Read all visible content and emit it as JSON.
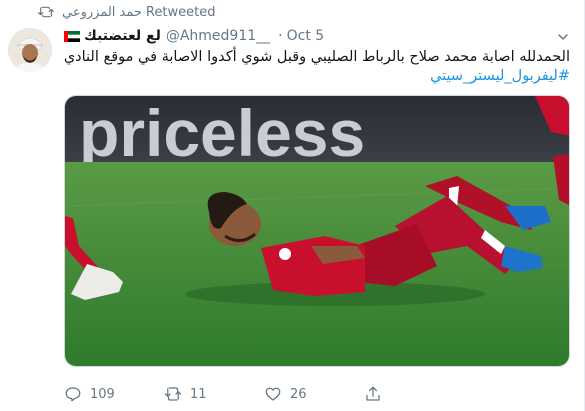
{
  "retweet": {
    "name": "حمد المزروعي",
    "label": "Retweeted"
  },
  "author": {
    "display_name": "لع لعتضتبك",
    "handle": "@Ahmed911__",
    "time": "Oct 5"
  },
  "tweet": {
    "line1": "الحمدلله اصابة محمد صلاح بالرباط الصليبي وقبل شوي أكدوا الاصابة في موقع النادي",
    "hashtag": "#ليفربول_ليستر_سيتي"
  },
  "media": {
    "banner_text": "priceless"
  },
  "actions": {
    "replies": "109",
    "retweets": "11",
    "likes": "26"
  },
  "colors": {
    "link": "#1b95e0",
    "muted": "#657786",
    "pitch": "#3f8a35",
    "kit": "#c8102e"
  }
}
